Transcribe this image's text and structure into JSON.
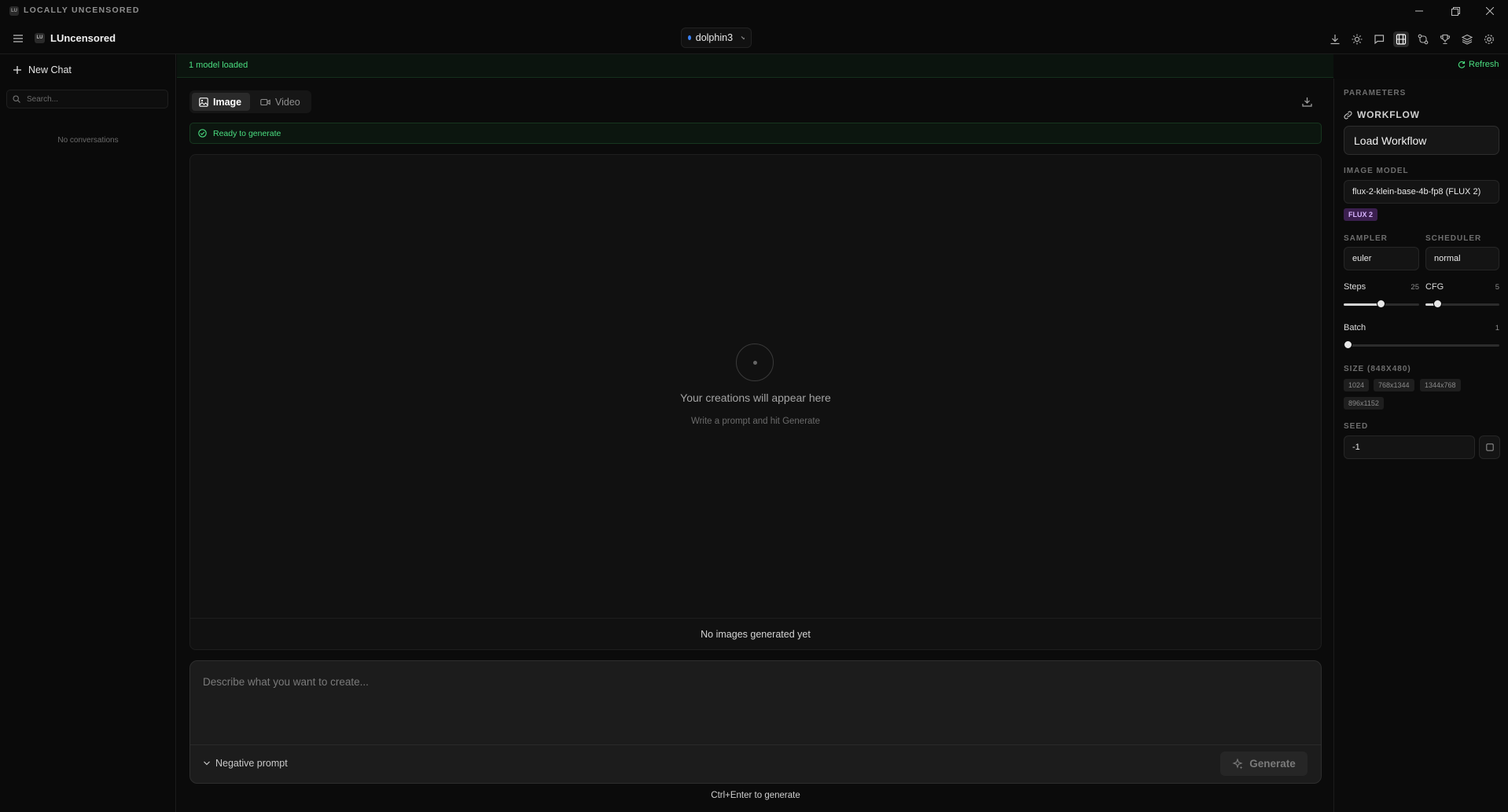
{
  "window": {
    "title": "LOCALLY UNCENSORED",
    "logo_text": "LU"
  },
  "header": {
    "brand_logo_text": "LU",
    "brand_name": "LUncensored",
    "model_select": {
      "value": "dolphin3",
      "status_color": "#3b82f6"
    },
    "icons": [
      "download-icon",
      "sun-icon",
      "chat-icon",
      "image-studio-icon",
      "compare-icon",
      "trophy-icon",
      "layers-icon",
      "settings-icon"
    ]
  },
  "sidebar": {
    "new_chat_label": "New Chat",
    "search_placeholder": "Search...",
    "empty_text": "No conversations"
  },
  "status": {
    "text": "1 model loaded",
    "refresh_label": "Refresh",
    "accent": "#4ade80"
  },
  "main": {
    "tabs": [
      {
        "label": "Image",
        "active": true
      },
      {
        "label": "Video",
        "active": false
      }
    ],
    "ready_text": "Ready to generate",
    "empty_title": "Your creations will appear here",
    "empty_subtitle": "Write a prompt and hit Generate",
    "canvas_footer": "No images generated yet",
    "prompt_placeholder": "Describe what you want to create...",
    "negative_prompt_label": "Negative prompt",
    "generate_label": "Generate",
    "hint": "Ctrl+Enter to generate"
  },
  "panel": {
    "title": "PARAMETERS",
    "workflow_label": "WORKFLOW",
    "load_workflow_label": "Load Workflow",
    "image_model_label": "IMAGE MODEL",
    "image_model_value": "flux-2-klein-base-4b-fp8 (FLUX 2)",
    "model_badge": "FLUX 2",
    "sampler_label": "SAMPLER",
    "sampler_value": "euler",
    "scheduler_label": "SCHEDULER",
    "scheduler_value": "normal",
    "steps": {
      "label": "Steps",
      "value": "25",
      "level": 0.49
    },
    "cfg": {
      "label": "CFG",
      "value": "5",
      "level": 0.16
    },
    "batch": {
      "label": "Batch",
      "value": "1",
      "level": 0.0
    },
    "size_label": "SIZE (848X480)",
    "size_presets": [
      "1024",
      "768x1344",
      "1344x768",
      "896x1152"
    ],
    "seed_label": "SEED",
    "seed_value": "-1"
  }
}
